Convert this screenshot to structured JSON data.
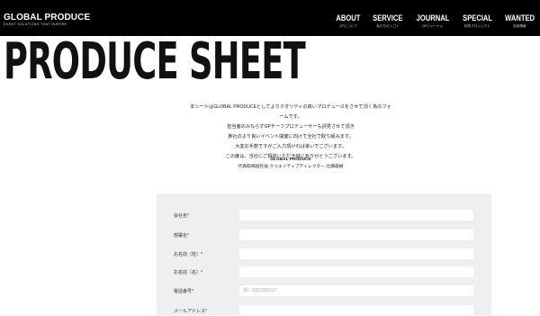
{
  "header": {
    "logo": {
      "name": "GLOBAL PRODUCE",
      "tagline": "EVENT SOLUTIONS THAT INSPIRE"
    },
    "nav": [
      {
        "label": "ABOUT",
        "sub": "GPについて"
      },
      {
        "label": "SERVICE",
        "sub": "私たちのシゴト"
      },
      {
        "label": "JOURNAL",
        "sub": "GPジャーナル"
      },
      {
        "label": "SPECIAL",
        "sub": "特別プロジェクト"
      },
      {
        "label": "WANTED",
        "sub": "採用情報"
      }
    ]
  },
  "page_title": "PRODUCE SHEET",
  "intro": [
    "本シートはGLOBAL PRODUCEとしてよりクオリティの高いプロデュースをさせて頂く為のフォームです。",
    "担当者のみならずGPチーフプロデューサーも評見させて頂き",
    "貴社のより良いイベント開催に向けて全社で取り組みます。",
    "大変お手数ですがご入力頂ければ幸いでございます。",
    "この度は、当社にご相談いただき誠にありがとうございます。"
  ],
  "signature": {
    "company": "GLOBAL PRODUCE",
    "person": "代表取締役社長 クリエイティブディレクター 北畑森樹"
  },
  "form": {
    "fields": [
      {
        "label": "会社名*",
        "value": "",
        "placeholder": ""
      },
      {
        "label": "部署名*",
        "value": "",
        "placeholder": ""
      },
      {
        "label": "お名前（姓）*",
        "value": "",
        "placeholder": ""
      },
      {
        "label": "お名前（名）*",
        "value": "",
        "placeholder": ""
      },
      {
        "label": "電話番号*",
        "value": "",
        "placeholder": "例）0357282117"
      },
      {
        "label": "メールアドレス*",
        "value": "",
        "placeholder": ""
      }
    ]
  }
}
